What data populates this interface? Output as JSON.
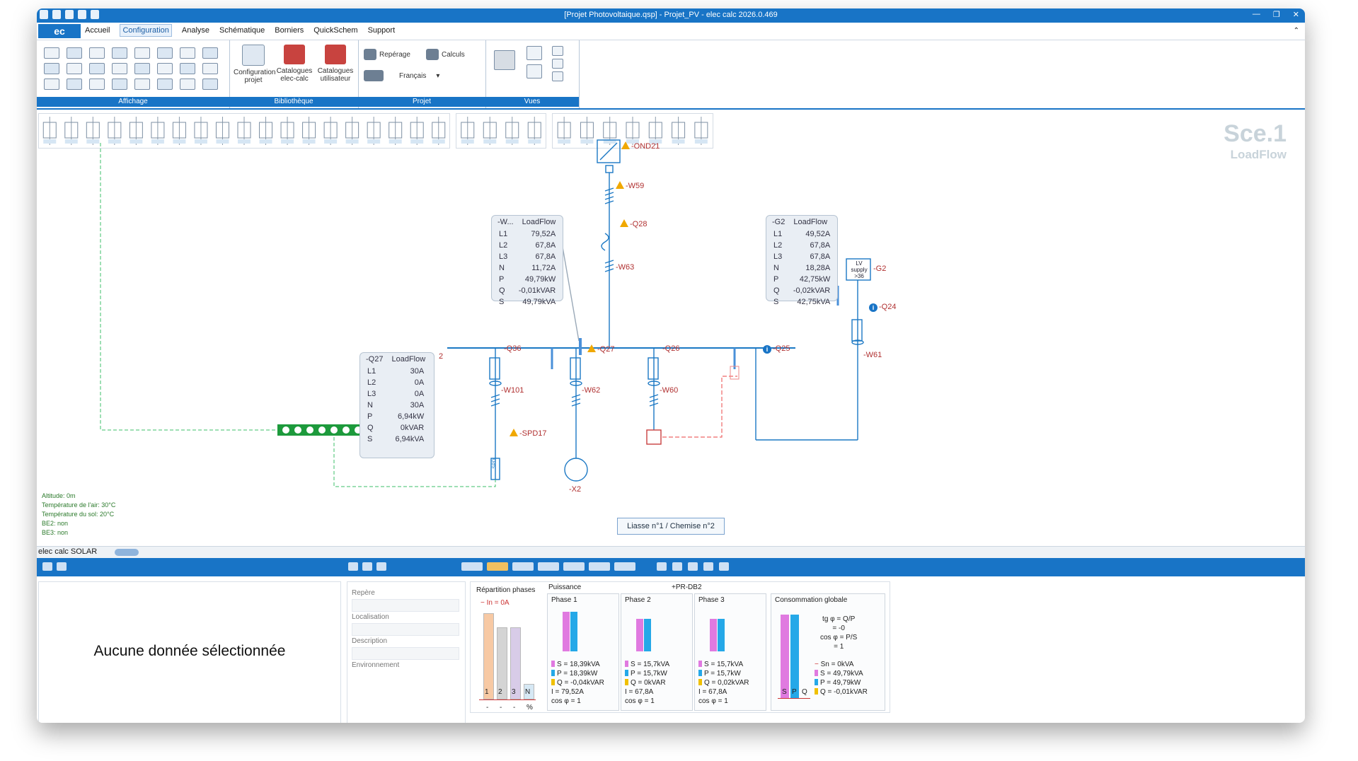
{
  "window": {
    "title": "[Projet Photovoltaique.qsp] - Projet_PV - elec calc 2026.0.469",
    "logo": "ec"
  },
  "menu": {
    "items": [
      "Accueil",
      "Configuration",
      "Analyse",
      "Schématique",
      "Borniers",
      "QuickSchem",
      "Support"
    ],
    "active": "Configuration"
  },
  "ribbon": {
    "groups": {
      "affichage": "Affichage",
      "bibliotheque": "Bibliothèque",
      "projet": "Projet",
      "vues": "Vues"
    },
    "config_projet": "Configuration projet",
    "catalogues_ec": "Catalogues elec-calc",
    "catalogues_user": "Catalogues utilisateur",
    "reperage": "Repérage",
    "calculs": "Calculs",
    "langue": "Français"
  },
  "scenario": {
    "name": "Sce.1",
    "mode": "LoadFlow"
  },
  "environment": {
    "altitude": "Altitude: 0m",
    "temp_air": "Température de l'air: 30°C",
    "temp_sol": "Température du sol: 20°C",
    "be2": "BE2: non",
    "be3": "BE3: non"
  },
  "loadflow_boxes": {
    "w": {
      "id": "-W...",
      "title": "LoadFlow",
      "rows": [
        [
          "L1",
          "79,52A"
        ],
        [
          "L2",
          "67,8A"
        ],
        [
          "L3",
          "67,8A"
        ],
        [
          "N",
          "11,72A"
        ],
        [
          "P",
          "49,79kW"
        ],
        [
          "Q",
          "-0,01kVAR"
        ],
        [
          "S",
          "49,79kVA"
        ]
      ]
    },
    "g2": {
      "id": "-G2",
      "title": "LoadFlow",
      "rows": [
        [
          "L1",
          "49,52A"
        ],
        [
          "L2",
          "67,8A"
        ],
        [
          "L3",
          "67,8A"
        ],
        [
          "N",
          "18,28A"
        ],
        [
          "P",
          "42,75kW"
        ],
        [
          "Q",
          "-0,02kVAR"
        ],
        [
          "S",
          "42,75kVA"
        ]
      ]
    },
    "q27": {
      "id": "-Q27",
      "title": "LoadFlow",
      "rows": [
        [
          "L1",
          "30A"
        ],
        [
          "L2",
          "0A"
        ],
        [
          "L3",
          "0A"
        ],
        [
          "N",
          "30A"
        ],
        [
          "P",
          "6,94kW"
        ],
        [
          "Q",
          "0kVAR"
        ],
        [
          "S",
          "6,94kVA"
        ]
      ]
    }
  },
  "labels": {
    "ond21": "-OND21",
    "w59": "-W59",
    "q28": "-Q28",
    "w63": "-W63",
    "q36": "-Q36",
    "q27": "-Q27",
    "q26": "-Q26",
    "q25": "-Q25",
    "w101": "-W101",
    "w62": "-W62",
    "w60": "-W60",
    "spd17": "-SPD17",
    "x2": "-X2",
    "g2": "-G2",
    "q24": "-Q24",
    "w61": "-W61",
    "lv_supply": "LV supply >36",
    "bus_num": "2",
    "spd_box": "SPD"
  },
  "liasse": "Liasse n°1 / Chemise n°2",
  "status_tab": "elec calc SOLAR",
  "bottom": {
    "no_data": "Aucune donnée sélectionnée",
    "props": [
      "Repère",
      "Localisation",
      "Description",
      "Environnement"
    ],
    "repartition": {
      "title": "Répartition phases",
      "legend": "In = 0A",
      "labels": [
        "1",
        "2",
        "3",
        "N"
      ],
      "footer": [
        "-",
        "-",
        "-",
        "%"
      ]
    },
    "puissance_title": "Puissance",
    "pr_db2": "+PR-DB2",
    "phases": [
      {
        "title": "Phase 1",
        "s": "S = 18,39kVA",
        "p": "P = 18,39kW",
        "q": "Q = -0,04kVAR",
        "i": "I = 79,52A",
        "cos": "cos φ = 1"
      },
      {
        "title": "Phase 2",
        "s": "S = 15,7kVA",
        "p": "P = 15,7kW",
        "q": "Q = 0kVAR",
        "i": "I = 67,8A",
        "cos": "cos φ = 1"
      },
      {
        "title": "Phase 3",
        "s": "S = 15,7kVA",
        "p": "P = 15,7kW",
        "q": "Q = 0,02kVAR",
        "i": "I = 67,8A",
        "cos": "cos φ = 1"
      }
    ],
    "global": {
      "title": "Consommation globale",
      "formula": [
        "tg φ = Q/P",
        "= -0",
        "cos φ = P/S",
        "= 1"
      ],
      "sn": "Sn = 0kVA",
      "s": "S = 49,79kVA",
      "p": "P = 49,79kW",
      "q": "Q = -0,01kVAR",
      "bar_labels": [
        "S",
        "P",
        "Q"
      ]
    }
  },
  "colors": {
    "accent": "#1874c6",
    "s_bar": "#e07ae0",
    "p_bar": "#25a8e8",
    "q_bar": "#f0c000",
    "schematic": "#1b78c4",
    "link_green": "#3cbf6a",
    "neutral": "#ee8888"
  }
}
